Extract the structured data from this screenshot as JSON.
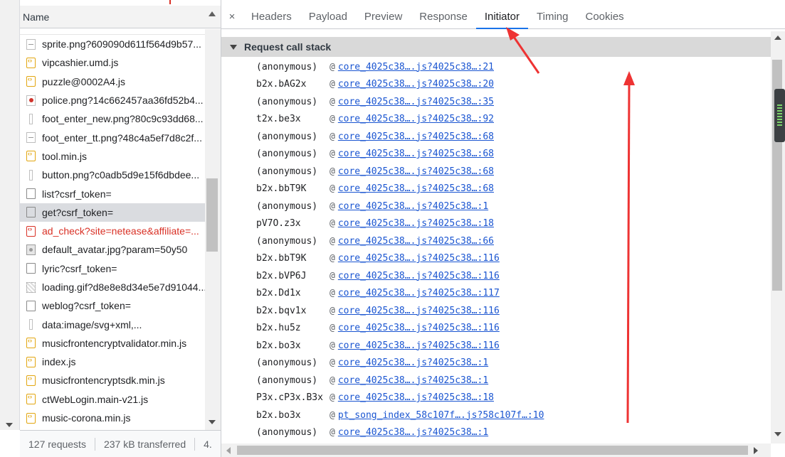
{
  "request_list": {
    "header": "Name",
    "items": [
      {
        "name": "sprite.png?609090d611f564d9b57...",
        "type": "img-line",
        "selected": false,
        "error": false
      },
      {
        "name": "vipcashier.umd.js",
        "type": "js",
        "selected": false,
        "error": false
      },
      {
        "name": "puzzle@0002A4.js",
        "type": "js",
        "selected": false,
        "error": false
      },
      {
        "name": "police.png?14c662457aa36fd52b4...",
        "type": "img-red",
        "selected": false,
        "error": false
      },
      {
        "name": "foot_enter_new.png?80c9c93dd68...",
        "type": "img-thin",
        "selected": false,
        "error": false
      },
      {
        "name": "foot_enter_tt.png?48c4a5ef7d8c2f...",
        "type": "img-line",
        "selected": false,
        "error": false
      },
      {
        "name": "tool.min.js",
        "type": "js",
        "selected": false,
        "error": false
      },
      {
        "name": "button.png?c0adb5d9e15f6dbdee...",
        "type": "img-thin",
        "selected": false,
        "error": false
      },
      {
        "name": "list?csrf_token=",
        "type": "doc",
        "selected": false,
        "error": false
      },
      {
        "name": "get?csrf_token=",
        "type": "doc",
        "selected": true,
        "error": false
      },
      {
        "name": "ad_check?site=netease&affiliate=...",
        "type": "jserr",
        "selected": false,
        "error": true
      },
      {
        "name": "default_avatar.jpg?param=50y50",
        "type": "img-avatar",
        "selected": false,
        "error": false
      },
      {
        "name": "lyric?csrf_token=",
        "type": "doc",
        "selected": false,
        "error": false
      },
      {
        "name": "loading.gif?d8e8e8d34e5e7d91044...",
        "type": "img-gif",
        "selected": false,
        "error": false
      },
      {
        "name": "weblog?csrf_token=",
        "type": "doc",
        "selected": false,
        "error": false
      },
      {
        "name": "data:image/svg+xml,...",
        "type": "img-thin",
        "selected": false,
        "error": false
      },
      {
        "name": "musicfrontencryptvalidator.min.js",
        "type": "js",
        "selected": false,
        "error": false
      },
      {
        "name": "index.js",
        "type": "js",
        "selected": false,
        "error": false
      },
      {
        "name": "musicfrontencryptsdk.min.js",
        "type": "js",
        "selected": false,
        "error": false
      },
      {
        "name": "ctWebLogin.main-v21.js",
        "type": "js",
        "selected": false,
        "error": false
      },
      {
        "name": "music-corona.min.js",
        "type": "js",
        "selected": false,
        "error": false
      }
    ]
  },
  "status_bar": {
    "requests": "127 requests",
    "transferred": "237 kB transferred",
    "extra": "4."
  },
  "tabs": {
    "close": "×",
    "items": [
      "Headers",
      "Payload",
      "Preview",
      "Response",
      "Initiator",
      "Timing",
      "Cookies"
    ],
    "active_index": 4
  },
  "initiator": {
    "section_title": "Request call stack",
    "frames": [
      {
        "fn": "(anonymous)",
        "loc": "core_4025c38….js?4025c38…:21"
      },
      {
        "fn": "b2x.bAG2x",
        "loc": "core_4025c38….js?4025c38…:20"
      },
      {
        "fn": "(anonymous)",
        "loc": "core_4025c38….js?4025c38…:35"
      },
      {
        "fn": "t2x.be3x",
        "loc": "core_4025c38….js?4025c38…:92"
      },
      {
        "fn": "(anonymous)",
        "loc": "core_4025c38….js?4025c38…:68"
      },
      {
        "fn": "(anonymous)",
        "loc": "core_4025c38….js?4025c38…:68"
      },
      {
        "fn": "(anonymous)",
        "loc": "core_4025c38….js?4025c38…:68"
      },
      {
        "fn": "b2x.bbT9K",
        "loc": "core_4025c38….js?4025c38…:68"
      },
      {
        "fn": "(anonymous)",
        "loc": "core_4025c38….js?4025c38…:1"
      },
      {
        "fn": "pV7O.z3x",
        "loc": "core_4025c38….js?4025c38…:18"
      },
      {
        "fn": "(anonymous)",
        "loc": "core_4025c38….js?4025c38…:66"
      },
      {
        "fn": "b2x.bbT9K",
        "loc": "core_4025c38….js?4025c38…:116"
      },
      {
        "fn": "b2x.bVP6J",
        "loc": "core_4025c38….js?4025c38…:116"
      },
      {
        "fn": "b2x.Dd1x",
        "loc": "core_4025c38….js?4025c38…:117"
      },
      {
        "fn": "b2x.bqv1x",
        "loc": "core_4025c38….js?4025c38…:116"
      },
      {
        "fn": "b2x.hu5z",
        "loc": "core_4025c38….js?4025c38…:116"
      },
      {
        "fn": "b2x.bo3x",
        "loc": "core_4025c38….js?4025c38…:116"
      },
      {
        "fn": "(anonymous)",
        "loc": "core_4025c38….js?4025c38…:1"
      },
      {
        "fn": "(anonymous)",
        "loc": "core_4025c38….js?4025c38…:1"
      },
      {
        "fn": "P3x.cP3x.B3x",
        "loc": "core_4025c38….js?4025c38…:18"
      },
      {
        "fn": "b2x.bo3x",
        "loc": "pt_song_index_58c107f….js?58c107f…:10"
      },
      {
        "fn": "(anonymous)",
        "loc": "core_4025c38….js?4025c38…:1"
      }
    ]
  },
  "colors": {
    "accent": "#1a73e8",
    "link": "#1a55d1",
    "error": "#d93025",
    "annotation": "#ee3333"
  },
  "icons": {
    "close": "close-icon",
    "collapse": "triangle-down-icon",
    "sort": "sort-asc-icon"
  }
}
